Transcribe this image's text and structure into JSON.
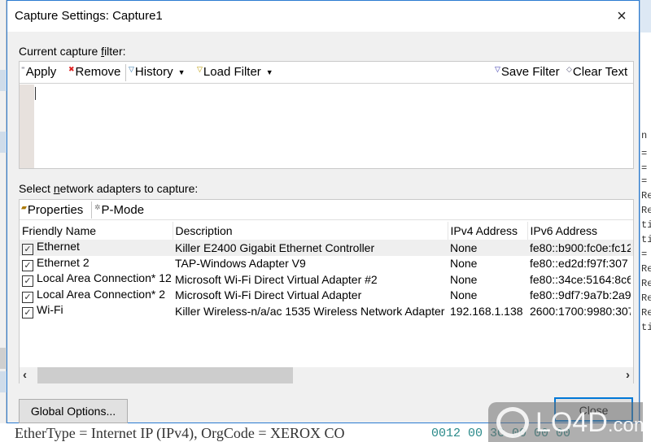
{
  "dialog": {
    "title": "Capture Settings: Capture1",
    "close_icon": "×"
  },
  "filter": {
    "label_prefix": "Current capture ",
    "label_underlined": "f",
    "label_suffix": "ilter:",
    "toolbar": {
      "apply": "Apply",
      "remove": "Remove",
      "history": "History",
      "load_filter": "Load Filter",
      "save_filter": "Save Filter",
      "clear_text": "Clear Text"
    },
    "value": ""
  },
  "adapters": {
    "label_prefix": "Select ",
    "label_underlined": "n",
    "label_suffix": "etwork adapters to capture:",
    "toolbar": {
      "properties": "Properties",
      "pmode": "P-Mode"
    },
    "columns": [
      "Friendly Name",
      "Description",
      "IPv4 Address",
      "IPv6 Address"
    ],
    "rows": [
      {
        "checked": true,
        "name": "Ethernet",
        "description": "Killer E2400 Gigabit Ethernet Controller",
        "ipv4": "None",
        "ipv6": "fe80::b900:fc0e:fc12"
      },
      {
        "checked": true,
        "name": "Ethernet 2",
        "description": "TAP-Windows Adapter V9",
        "ipv4": "None",
        "ipv6": "fe80::ed2d:f97f:307"
      },
      {
        "checked": true,
        "name": "Local Area Connection* 12",
        "description": "Microsoft Wi-Fi Direct Virtual Adapter #2",
        "ipv4": "None",
        "ipv6": "fe80::34ce:5164:8c6"
      },
      {
        "checked": true,
        "name": "Local Area Connection* 2",
        "description": "Microsoft Wi-Fi Direct Virtual Adapter",
        "ipv4": "None",
        "ipv6": "fe80::9df7:9a7b:2a9"
      },
      {
        "checked": true,
        "name": "Wi-Fi",
        "description": "Killer Wireless-n/a/ac 1535 Wireless Network Adapter",
        "ipv4": "192.168.1.138",
        "ipv6": "2600:1700:9980:307"
      }
    ]
  },
  "buttons": {
    "global_options": "Global Options...",
    "close": "Close"
  },
  "background": {
    "bottom_text": "EtherType = Internet IP (IPv4), OrgCode = XEROX CO",
    "bottom_hex": "0012   00  3C  00  00  00",
    "right_lines": [
      "n",
      "=",
      "=",
      "=",
      "Re",
      "Re",
      "ti",
      "ti",
      "=",
      "Re",
      "Re",
      "Re",
      "Re",
      "ti"
    ]
  },
  "watermark": {
    "text": "LO4D",
    "suffix": ".com"
  }
}
